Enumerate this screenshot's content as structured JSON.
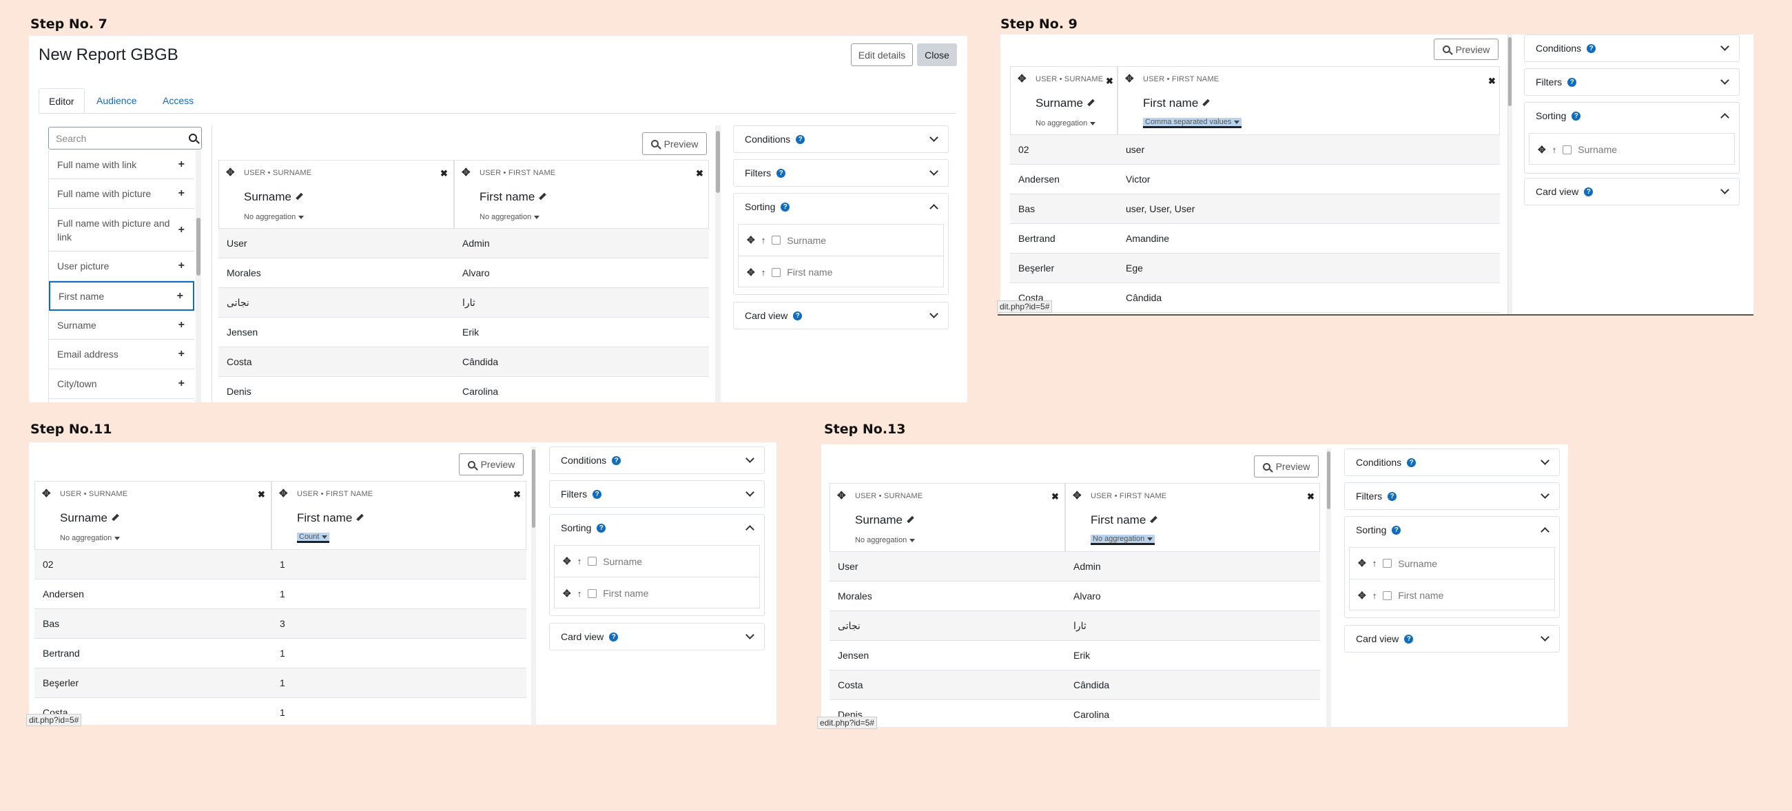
{
  "steps": {
    "s7": {
      "title": "Step No. 7"
    },
    "s9": {
      "title": "Step No. 9"
    },
    "s11": {
      "title": "Step No.11"
    },
    "s13": {
      "title": "Step No.13"
    }
  },
  "report": {
    "title": "New Report GBGB",
    "edit_details": "Edit details",
    "close": "Close",
    "tabs": [
      "Editor",
      "Audience",
      "Access"
    ],
    "search_placeholder": "Search",
    "sidebar_items": [
      "Full name with link",
      "Full name with picture",
      "Full name with picture and link",
      "User picture",
      "First name",
      "Surname",
      "Email address",
      "City/town"
    ]
  },
  "preview_label": "Preview",
  "columns": {
    "surname_caption": "USER • SURNAME",
    "surname_title": "Surname",
    "first_caption": "USER • FIRST NAME",
    "first_title": "First name"
  },
  "aggregation": {
    "none": "No aggregation",
    "csv": "Comma separated values",
    "count": "Count"
  },
  "accordion": {
    "conditions": "Conditions",
    "filters": "Filters",
    "sorting": "Sorting",
    "card_view": "Card view"
  },
  "sort_fields": [
    "Surname",
    "First name"
  ],
  "status_url": "edit.php?id=5#",
  "status_url_short": "dit.php?id=5#",
  "rows_default": [
    [
      "User",
      "Admin"
    ],
    [
      "Morales",
      "Alvaro"
    ],
    [
      "نجاتی",
      "ثارا"
    ],
    [
      "Jensen",
      "Erik"
    ],
    [
      "Costa",
      "Cândida"
    ],
    [
      "Denis",
      "Carolina"
    ]
  ],
  "rows_csv": [
    [
      "02",
      "user"
    ],
    [
      "Andersen",
      "Victor"
    ],
    [
      "Bas",
      "user, User, User"
    ],
    [
      "Bertrand",
      "Amandine"
    ],
    [
      "Beşerler",
      "Ege"
    ],
    [
      "Costa",
      "Cândida"
    ]
  ],
  "rows_count": [
    [
      "02",
      "1"
    ],
    [
      "Andersen",
      "1"
    ],
    [
      "Bas",
      "3"
    ],
    [
      "Bertrand",
      "1"
    ],
    [
      "Beşerler",
      "1"
    ],
    [
      "Costa",
      "1"
    ]
  ],
  "colors": {
    "page_bg": "#fce7da",
    "link": "#0f6cbf",
    "highlight": "#b9d4ee"
  }
}
